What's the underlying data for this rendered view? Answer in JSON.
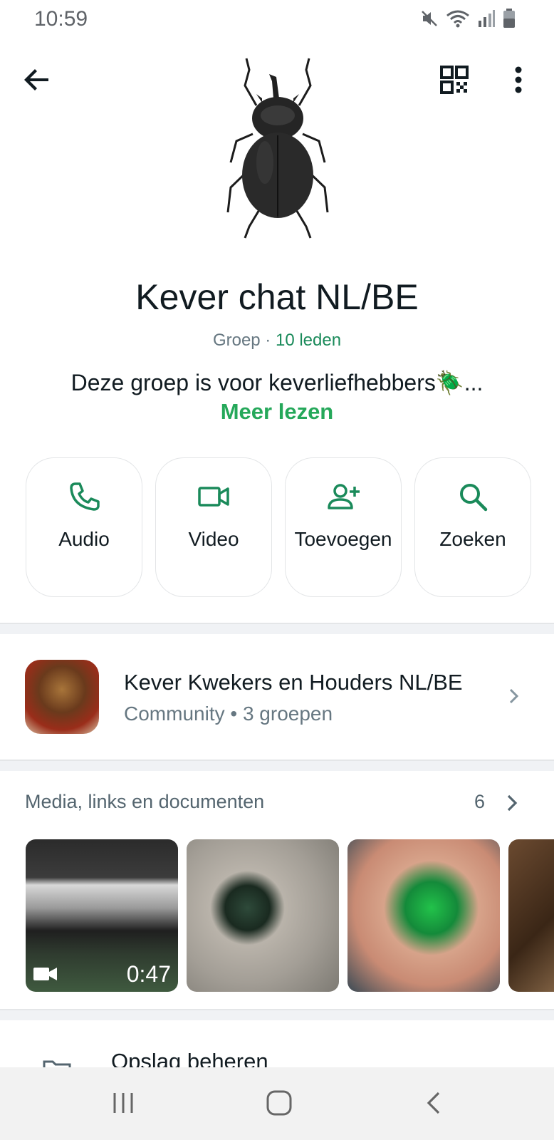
{
  "status_bar": {
    "time": "10:59",
    "icons": [
      "mute-icon",
      "wifi-icon",
      "signal-icon",
      "battery-icon"
    ]
  },
  "header": {
    "back": "back-arrow-icon",
    "qr": "qr-code-icon",
    "menu": "more-vert-icon"
  },
  "group": {
    "name": "Kever chat NL/BE",
    "type_label": "Groep · ",
    "members": "10 leden",
    "description": "Deze groep is voor keverliefhebbers🪲...",
    "read_more": "Meer lezen"
  },
  "actions": [
    {
      "label": "Audio",
      "icon": "phone-icon"
    },
    {
      "label": "Video",
      "icon": "video-camera-icon"
    },
    {
      "label": "Toevoegen",
      "icon": "add-person-icon"
    },
    {
      "label": "Zoeken",
      "icon": "search-icon"
    }
  ],
  "community": {
    "title": "Kever Kwekers en Houders NL/BE",
    "subtitle": "Community • 3 groepen"
  },
  "media": {
    "header": "Media, links en documenten",
    "count": "6",
    "video_duration": "0:47"
  },
  "storage": {
    "label": "Opslag beheren"
  },
  "colors": {
    "accent": "#25a85a",
    "members": "#1a8a5a",
    "secondary_text": "#667781"
  }
}
